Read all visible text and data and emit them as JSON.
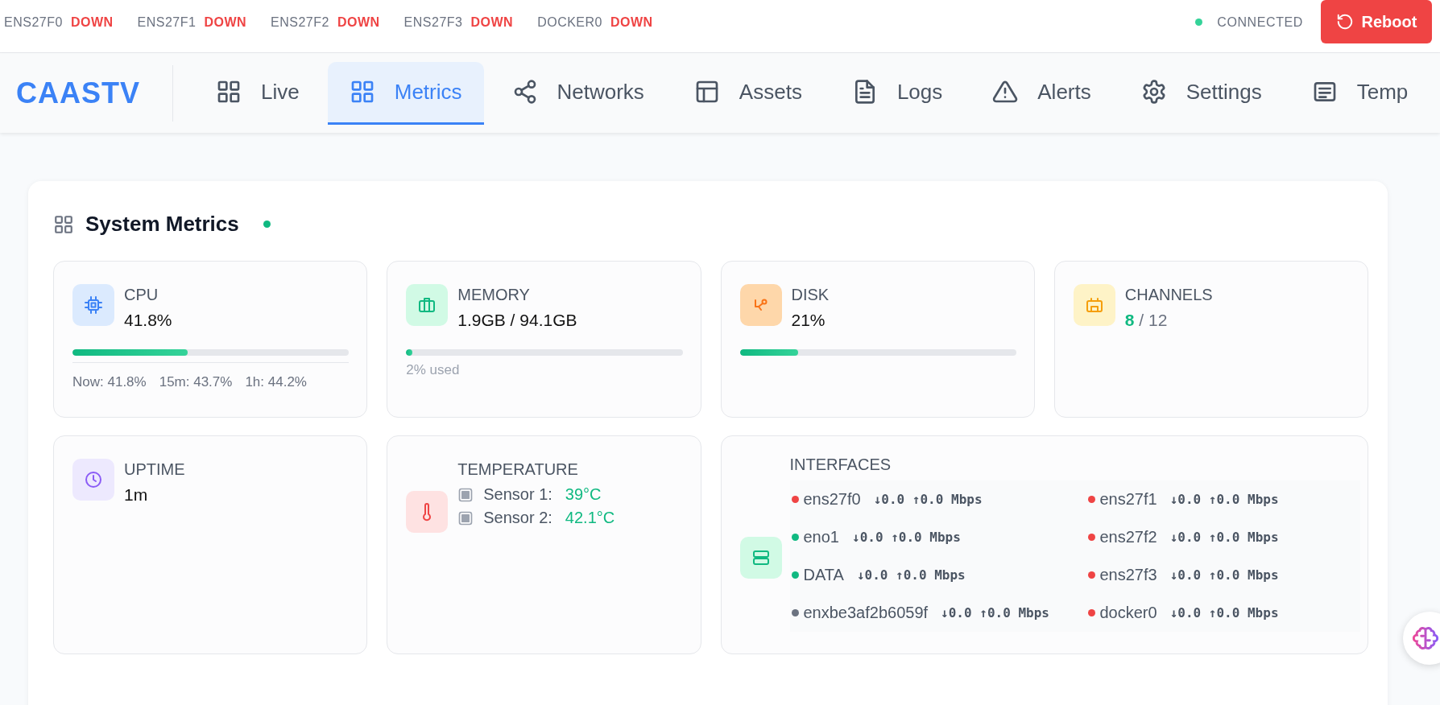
{
  "status_bar": {
    "interfaces": [
      {
        "name": "ENS27F0",
        "state": "DOWN"
      },
      {
        "name": "ENS27F1",
        "state": "DOWN"
      },
      {
        "name": "ENS27F2",
        "state": "DOWN"
      },
      {
        "name": "ENS27F3",
        "state": "DOWN"
      },
      {
        "name": "DOCKER0",
        "state": "DOWN"
      }
    ],
    "connection": "CONNECTED",
    "reboot": "Reboot"
  },
  "nav": {
    "logo": "CAASTV",
    "tabs": [
      {
        "label": "Live",
        "selected": false
      },
      {
        "label": "Metrics",
        "selected": true
      },
      {
        "label": "Networks",
        "selected": false
      },
      {
        "label": "Assets",
        "selected": false
      },
      {
        "label": "Logs",
        "selected": false
      },
      {
        "label": "Alerts",
        "selected": false
      },
      {
        "label": "Settings",
        "selected": false
      },
      {
        "label": "Temp",
        "selected": false
      }
    ]
  },
  "metrics": {
    "title": "System Metrics",
    "cards": [
      {
        "kind": "usage",
        "label": "CPU",
        "value": "41.8%",
        "level": 0.418,
        "stats": [
          {
            "label": "Now:",
            "value": "41.8%"
          },
          {
            "label": "15m:",
            "value": "43.7%"
          },
          {
            "label": "1h:",
            "value": "44.2%"
          }
        ]
      },
      {
        "kind": "usage",
        "label": "MEMORY",
        "value": "1.9GB / 94.1GB",
        "level": 0.02,
        "note": "2% used"
      },
      {
        "kind": "usage",
        "label": "DISK",
        "value": "21%",
        "level": 0.21
      },
      {
        "kind": "ratio",
        "label": "CHANNELS",
        "active": "8",
        "separator": "/",
        "total": "12"
      },
      {
        "kind": "stat",
        "label": "UPTIME",
        "value": "1m"
      },
      {
        "kind": "sensors",
        "label": "TEMPERATURE",
        "sensors": [
          {
            "label": "Sensor 1:",
            "value": "39°C"
          },
          {
            "label": "Sensor 2:",
            "value": "42.1°C"
          }
        ]
      },
      {
        "kind": "interfaces",
        "label": "INTERFACES",
        "items": [
          {
            "name": "ens27f0",
            "rate": "↓0.0 ↑0.0 Mbps",
            "color": "#ef4444"
          },
          {
            "name": "ens27f1",
            "rate": "↓0.0 ↑0.0 Mbps",
            "color": "#ef4444"
          },
          {
            "name": "eno1",
            "rate": "↓0.0 ↑0.0 Mbps",
            "color": "#10b981"
          },
          {
            "name": "ens27f2",
            "rate": "↓0.0 ↑0.0 Mbps",
            "color": "#ef4444"
          },
          {
            "name": "DATA",
            "rate": "↓0.0 ↑0.0 Mbps",
            "color": "#10b981"
          },
          {
            "name": "ens27f3",
            "rate": "↓0.0 ↑0.0 Mbps",
            "color": "#ef4444"
          },
          {
            "name": "enxbe3af2b6059f",
            "rate": "↓0.0 ↑0.0 Mbps",
            "color": "#6b7280"
          },
          {
            "name": "docker0",
            "rate": "↓0.0 ↑0.0 Mbps",
            "color": "#ef4444"
          }
        ]
      }
    ]
  }
}
